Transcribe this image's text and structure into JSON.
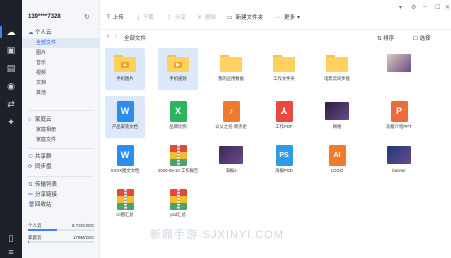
{
  "account": {
    "name": "139****7328"
  },
  "toolbar": {
    "upload": "上传",
    "download": "下载",
    "share": "分享",
    "delete": "删除",
    "new_folder": "新建文件夹",
    "more": "更多"
  },
  "path": {
    "current": "全部文件",
    "sort": "排序",
    "view": "选择"
  },
  "sidebar": {
    "personal": {
      "title": "个人云",
      "items": [
        "全部文件",
        "图片",
        "音乐",
        "视频",
        "文档",
        "其他"
      ]
    },
    "family": {
      "title": "家庭云",
      "items": [
        "家庭相册",
        "家庭文件"
      ]
    },
    "other": [
      "共享群",
      "同步盘"
    ],
    "bottom": [
      "传输列表",
      "分享链接",
      "回收站"
    ]
  },
  "usage": [
    {
      "label": "个人云",
      "value": "8.74G/20G",
      "fraction": 0.44
    },
    {
      "label": "家庭云",
      "value": "179M/20G",
      "fraction": 0.01
    }
  ],
  "files": [
    {
      "name": "手机图片",
      "kind": "folder",
      "badge": "▲",
      "selected": true
    },
    {
      "name": "手机视频",
      "kind": "folder",
      "badge": "▶",
      "selected": true
    },
    {
      "name": "我的应用数据",
      "kind": "folder"
    },
    {
      "name": "工作文件夹",
      "kind": "folder"
    },
    {
      "name": "电影云同步盘",
      "kind": "folder"
    },
    {
      "name": "",
      "kind": "image",
      "color": "#d9cdb8"
    },
    {
      "name": "产品安装文档",
      "kind": "doc",
      "letter": "W",
      "color": "#2d8cf0",
      "selected": true
    },
    {
      "name": "品牌比例",
      "kind": "doc",
      "letter": "X",
      "color": "#2db55d"
    },
    {
      "name": "以父之名-周杰伦",
      "kind": "doc",
      "letter": "♪",
      "color": "#f07a2d"
    },
    {
      "name": "工作PDF",
      "kind": "doc",
      "letter": "⅄",
      "color": "#e84a3f"
    },
    {
      "name": "网格",
      "kind": "image",
      "color": "#2a1f3d"
    },
    {
      "name": "功能介绍PPT",
      "kind": "doc",
      "letter": "P",
      "color": "#ef6a3a"
    },
    {
      "name": "XXXX图文文档",
      "kind": "doc",
      "letter": "W",
      "color": "#2d8cf0"
    },
    {
      "name": "2020-09-10 工作报告",
      "kind": "zip"
    },
    {
      "name": "海报2",
      "kind": "image",
      "color": "#3b2a56"
    },
    {
      "name": "海报PSD",
      "kind": "doc",
      "letter": "PS",
      "color": "#2f9ae6"
    },
    {
      "name": "LOGO",
      "kind": "doc",
      "letter": "AI",
      "color": "#f07a2d"
    },
    {
      "name": "banner",
      "kind": "image",
      "color": "#1a3a7a"
    },
    {
      "name": "UI图汇总",
      "kind": "zip"
    },
    {
      "name": "psd汇总",
      "kind": "zip"
    }
  ],
  "watermark": "新鼎手游·SJXINYI.COM"
}
